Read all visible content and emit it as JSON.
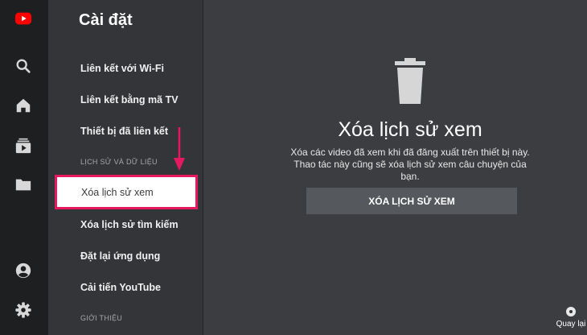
{
  "menu": {
    "title": "Cài đặt",
    "items": [
      {
        "label": "Liên kết với Wi-Fi"
      },
      {
        "label": "Liên kết bằng mã TV"
      },
      {
        "label": "Thiết bị đã liên kết"
      }
    ],
    "section_history": "LỊCH SỬ VÀ DỮ LIỆU",
    "selected_item": "Xóa lịch sử xem",
    "items_after": [
      {
        "label": "Xóa lịch sử tìm kiếm"
      },
      {
        "label": "Đặt lại ứng dụng"
      },
      {
        "label": "Cải tiến YouTube"
      }
    ],
    "section_about": "GIỚI THIỆU"
  },
  "panel": {
    "icon": "trash-icon",
    "title": "Xóa lịch sử xem",
    "description": "Xóa các video đã xem khi đã đăng xuất trên thiết bị này. Thao tác này cũng sẽ xóa lịch sử xem câu chuyện của bạn.",
    "button_label": "XÓA LỊCH SỬ XEM"
  },
  "back_hint": "Quay lại",
  "rail": {
    "icons": [
      "youtube-logo-icon",
      "search-icon",
      "home-icon",
      "subscriptions-icon",
      "library-icon",
      "account-icon",
      "settings-icon"
    ]
  },
  "colors": {
    "accent": "#e6185e",
    "youtube_red": "#ff0000",
    "panel_bg": "#3b3d40",
    "menu_bg": "#333538",
    "rail_bg": "#1e1f21"
  }
}
